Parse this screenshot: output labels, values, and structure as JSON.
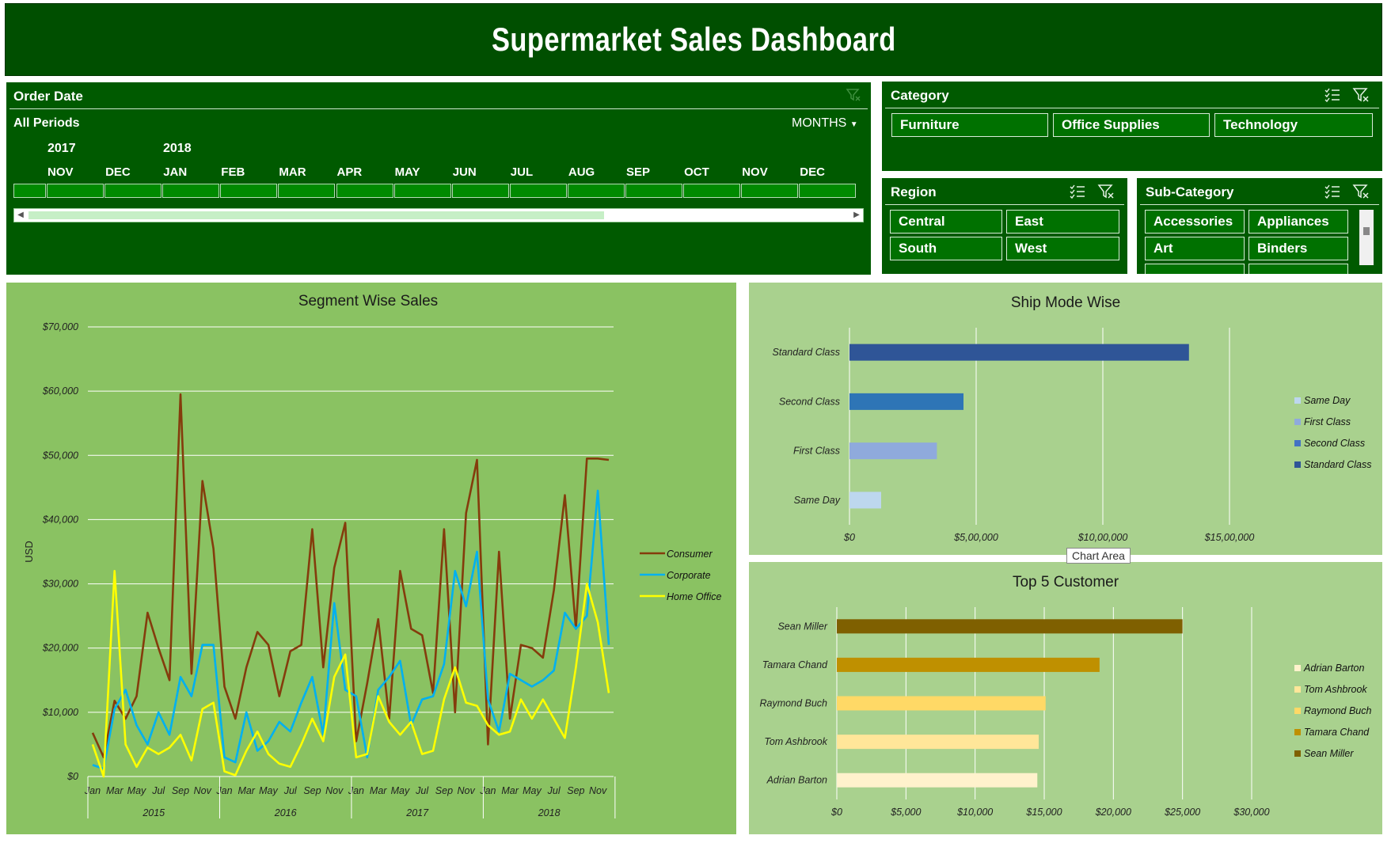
{
  "title": "Supermarket Sales Dashboard",
  "order_date": {
    "header": "Order Date",
    "all_periods": "All Periods",
    "level": "MONTHS",
    "years": [
      "2017",
      "2018"
    ],
    "months": [
      "NOV",
      "DEC",
      "JAN",
      "FEB",
      "MAR",
      "APR",
      "MAY",
      "JUN",
      "JUL",
      "AUG",
      "SEP",
      "OCT",
      "NOV",
      "DEC"
    ]
  },
  "category": {
    "header": "Category",
    "items": [
      "Furniture",
      "Office Supplies",
      "Technology"
    ]
  },
  "region": {
    "header": "Region",
    "items": [
      "Central",
      "East",
      "South",
      "West"
    ]
  },
  "subcategory": {
    "header": "Sub-Category",
    "items": [
      "Accessories",
      "Appliances",
      "Art",
      "Binders"
    ]
  },
  "tooltip": "Chart Area",
  "colors": {
    "title_bg": "#004f00",
    "panel_bg": "#005a00",
    "segment_bg": "#8ac262",
    "ship_bg": "#a9d18e",
    "consumer": "#843c0c",
    "corporate": "#00b0f0",
    "home_office": "#ffff00"
  },
  "chart_data": [
    {
      "type": "line",
      "title": "Segment Wise Sales",
      "ylabel": "USD",
      "ylim": [
        0,
        70000
      ],
      "yticks": [
        "$0",
        "$10,000",
        "$20,000",
        "$30,000",
        "$40,000",
        "$50,000",
        "$60,000",
        "$70,000"
      ],
      "xtick_labels": [
        "Jan",
        "Mar",
        "May",
        "Jul",
        "Sep",
        "Nov",
        "Jan",
        "Mar",
        "May",
        "Jul",
        "Sep",
        "Nov",
        "Jan",
        "Mar",
        "May",
        "Jul",
        "Sep",
        "Nov",
        "Jan",
        "Mar",
        "May",
        "Jul",
        "Sep",
        "Nov"
      ],
      "year_labels": [
        "2015",
        "2016",
        "2017",
        "2018"
      ],
      "legend_position": "right",
      "series": [
        {
          "name": "Consumer",
          "color": "#843c0c",
          "values": [
            6800,
            3000,
            11800,
            9000,
            12500,
            25500,
            20000,
            15000,
            59500,
            16000,
            46000,
            35500,
            14000,
            9000,
            17000,
            22500,
            20500,
            12500,
            19500,
            20500,
            38500,
            17000,
            32500,
            39500,
            5500,
            14500,
            24500,
            9000,
            32000,
            23000,
            22000,
            13000,
            38500,
            10000,
            41000,
            49300,
            5000,
            35000,
            9000,
            20500,
            20000,
            18500,
            29000,
            43800,
            23000,
            49500,
            49500,
            49300
          ]
        },
        {
          "name": "Corporate",
          "color": "#00b0f0",
          "values": [
            1800,
            1200,
            10500,
            13500,
            8000,
            5000,
            10000,
            6500,
            15500,
            12500,
            20500,
            20500,
            3000,
            2200,
            10000,
            4000,
            5500,
            8500,
            7000,
            11500,
            15500,
            6500,
            27000,
            13500,
            12500,
            3000,
            13500,
            15500,
            18000,
            8000,
            12000,
            12500,
            17500,
            32000,
            26500,
            35000,
            12000,
            7000,
            16000,
            15000,
            14000,
            15000,
            16500,
            25500,
            23000,
            25000,
            44500,
            20500
          ]
        },
        {
          "name": "Home Office",
          "color": "#ffff00",
          "values": [
            5000,
            0,
            32000,
            5000,
            1500,
            4500,
            3500,
            4500,
            6500,
            2500,
            10500,
            11500,
            800,
            200,
            4000,
            7000,
            3500,
            2000,
            1500,
            5000,
            9000,
            5500,
            15500,
            19000,
            3000,
            3500,
            12500,
            8500,
            6500,
            8500,
            3500,
            4000,
            12000,
            17000,
            11500,
            11000,
            8000,
            6500,
            7000,
            12000,
            9000,
            12000,
            9000,
            6000,
            17000,
            30000,
            24000,
            13000
          ]
        }
      ]
    },
    {
      "type": "bar",
      "orientation": "horizontal",
      "title": "Ship Mode Wise",
      "categories": [
        "Standard Class",
        "Second Class",
        "First Class",
        "Same Day"
      ],
      "values": [
        1340000,
        450000,
        345000,
        125000
      ],
      "colors": [
        "#2f5597",
        "#2e75b6",
        "#8faadc",
        "#bdd7ee"
      ],
      "xlim": [
        0,
        1500000
      ],
      "xticks": [
        "$0",
        "$5,00,000",
        "$10,00,000",
        "$15,00,000"
      ],
      "legend": [
        "Same Day",
        "First Class",
        "Second Class",
        "Standard Class"
      ],
      "legend_colors": [
        "#bdd7ee",
        "#8faadc",
        "#4472c4",
        "#2f5597"
      ],
      "legend_position": "right"
    },
    {
      "type": "bar",
      "orientation": "horizontal",
      "title": "Top 5 Customer",
      "categories": [
        "Sean Miller",
        "Tamara Chand",
        "Raymond Buch",
        "Tom Ashbrook",
        "Adrian Barton"
      ],
      "values": [
        25000,
        19000,
        15100,
        14600,
        14500
      ],
      "colors": [
        "#7f6000",
        "#bf9000",
        "#ffd966",
        "#ffe699",
        "#fff2cc"
      ],
      "xlim": [
        0,
        30000
      ],
      "xticks": [
        "$0",
        "$5,000",
        "$10,000",
        "$15,000",
        "$20,000",
        "$25,000",
        "$30,000"
      ],
      "legend": [
        "Adrian Barton",
        "Tom Ashbrook",
        "Raymond Buch",
        "Tamara Chand",
        "Sean Miller"
      ],
      "legend_colors": [
        "#fff2cc",
        "#ffe699",
        "#ffd966",
        "#bf9000",
        "#7f6000"
      ],
      "legend_position": "right"
    }
  ]
}
